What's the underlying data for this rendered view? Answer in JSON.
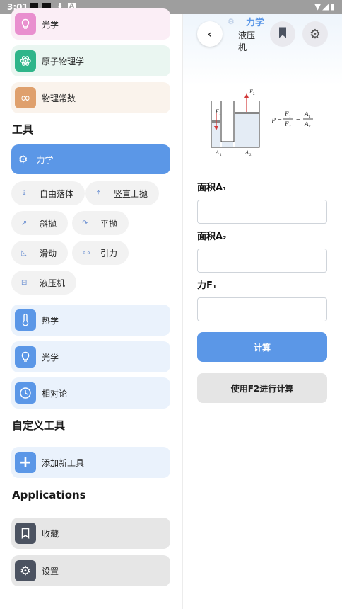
{
  "status_bar": {
    "time": "3:01"
  },
  "sidebar": {
    "items": [
      {
        "label": "光学",
        "color": "#e98fcf",
        "bg": "#fbeef6",
        "icon": "lightbulb-icon"
      },
      {
        "label": "原子物理学",
        "color": "#2fb58a",
        "bg": "#eaf6f1",
        "icon": "atom-icon"
      },
      {
        "label": "物理常数",
        "color": "#dfa06d",
        "bg": "#faf3ec",
        "icon": "infinity-icon"
      }
    ],
    "tools_title": "工具",
    "active_category": {
      "label": "力学",
      "icon": "gears-icon"
    },
    "chips": [
      "自由落体",
      "竖直上抛",
      "斜抛",
      "平抛",
      "滑动",
      "引力",
      "液压机"
    ],
    "categories": [
      {
        "label": "热学",
        "icon": "thermometer-icon"
      },
      {
        "label": "光学",
        "icon": "lightbulb-icon"
      },
      {
        "label": "相对论",
        "icon": "clock-icon"
      }
    ],
    "custom_title": "自定义工具",
    "add_tool": "添加新工具",
    "apps_title": "Applications",
    "apps": [
      {
        "label": "收藏",
        "icon": "bookmark-icon"
      },
      {
        "label": "设置",
        "icon": "gear-icon"
      }
    ]
  },
  "detail": {
    "category": "力学",
    "tool_name": "液压机",
    "fields": [
      {
        "label": "面积A₁",
        "value": ""
      },
      {
        "label": "面积A₂",
        "value": ""
      },
      {
        "label": "力F₁",
        "value": ""
      }
    ],
    "calc_label": "计算",
    "calc_f2_label": "使用F2进行计算",
    "formula": {
      "p": "p",
      "F1": "F",
      "F2": "F",
      "A1": "A",
      "A2": "A",
      "sub1": "1",
      "sub2": "2"
    }
  },
  "colors": {
    "accent": "#5b97e7",
    "card_light": "#eaf2fc",
    "app_card": "#e6e6e6",
    "app_badge": "#4c5361"
  }
}
